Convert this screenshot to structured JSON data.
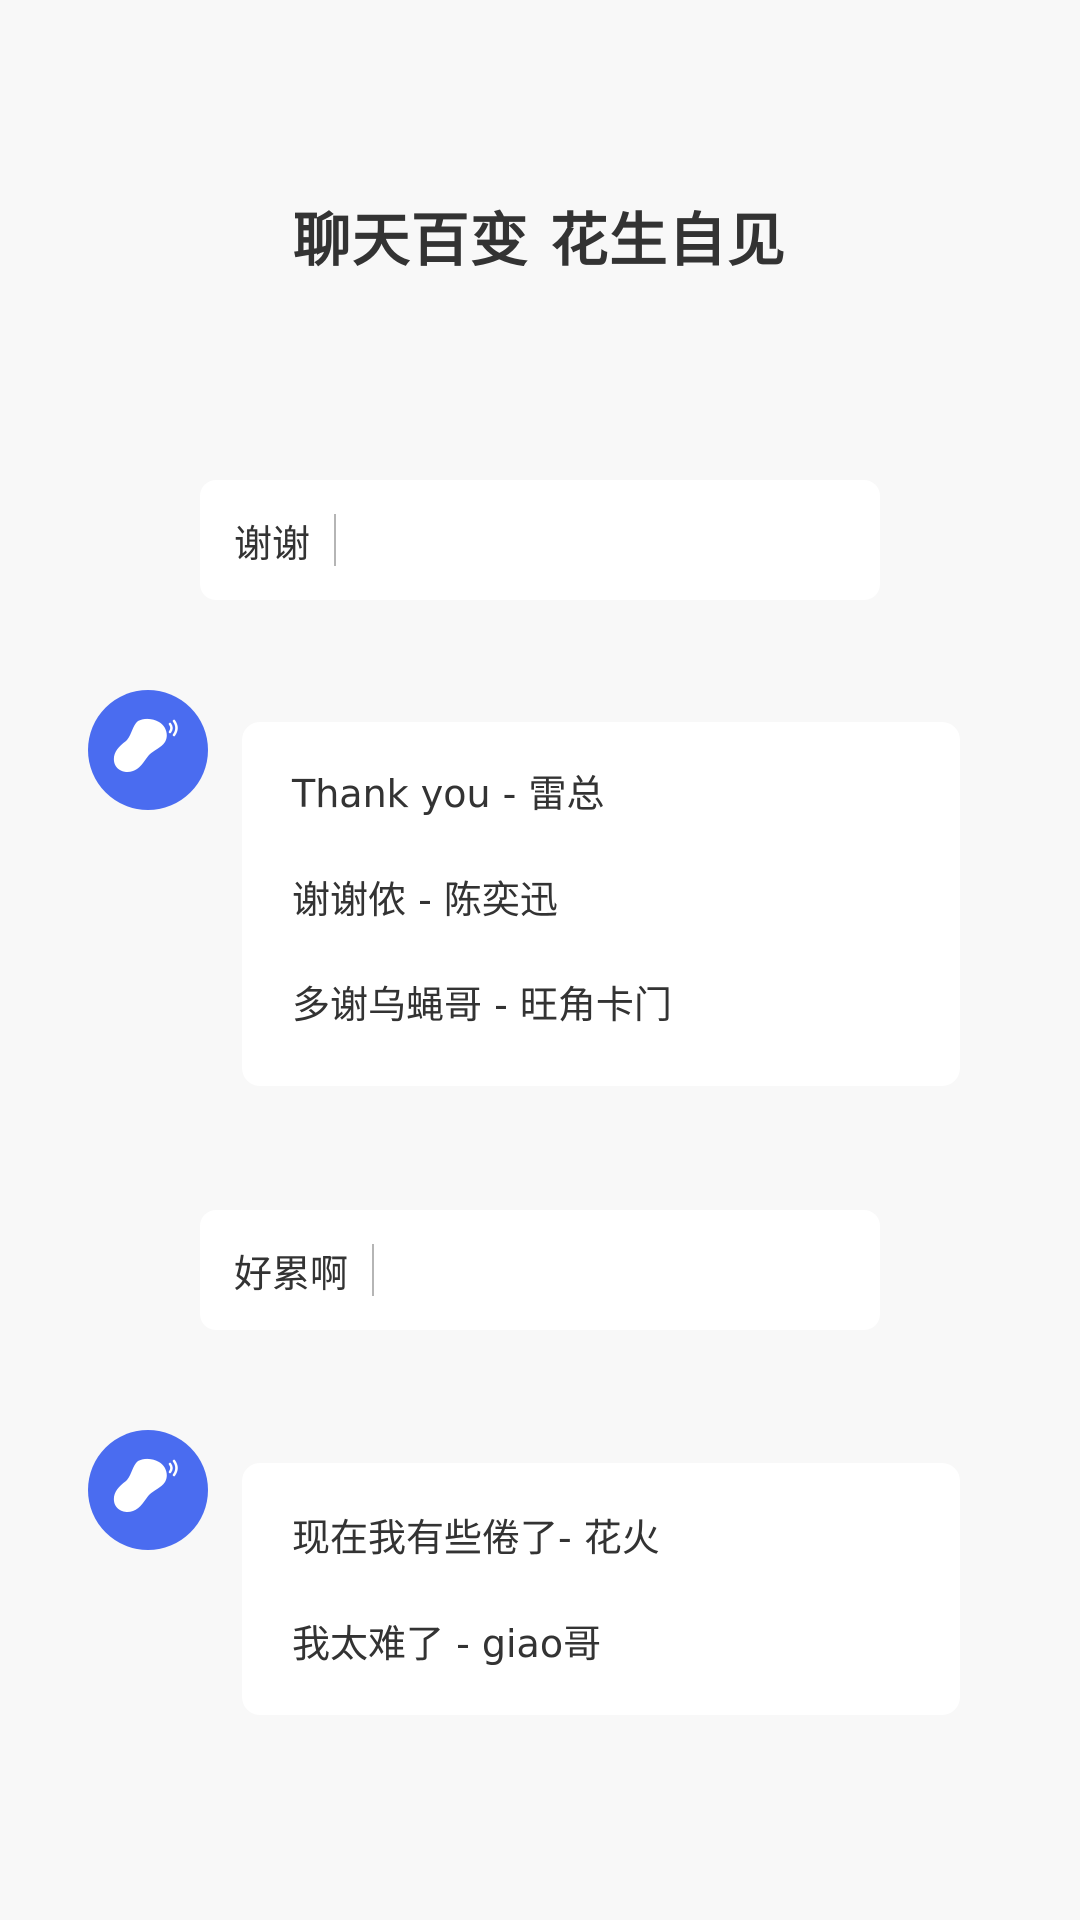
{
  "header": {
    "title": "聊天百变 花生自见"
  },
  "conversations": [
    {
      "query": "谢谢",
      "avatar_icon": "peanut-icon",
      "replies": [
        "Thank you - 雷总",
        "谢谢侬 - 陈奕迅",
        "多谢乌蝇哥 - 旺角卡门"
      ]
    },
    {
      "query": "好累啊",
      "avatar_icon": "peanut-icon",
      "replies": [
        "现在我有些倦了- 花火",
        "我太难了 - giao哥"
      ]
    }
  ],
  "colors": {
    "background": "#f8f8f8",
    "card": "#ffffff",
    "avatar": "#4a6cf0",
    "text": "#333333",
    "caret": "#b5b5b5"
  }
}
